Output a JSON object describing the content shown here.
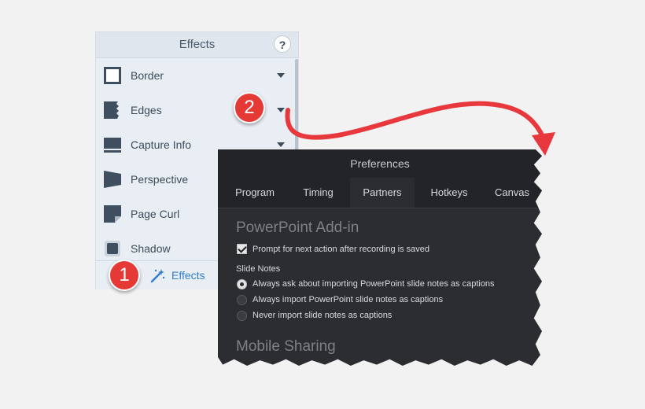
{
  "effects_panel": {
    "title": "Effects",
    "help_label": "?",
    "items": [
      {
        "label": "Border",
        "icon": "border-icon"
      },
      {
        "label": "Edges",
        "icon": "edges-icon"
      },
      {
        "label": "Capture Info",
        "icon": "capture-info-icon"
      },
      {
        "label": "Perspective",
        "icon": "perspective-icon"
      },
      {
        "label": "Page Curl",
        "icon": "page-curl-icon"
      },
      {
        "label": "Shadow",
        "icon": "shadow-icon"
      }
    ],
    "footer_label": "Effects",
    "footer_icon": "magic-wand-icon"
  },
  "preferences": {
    "title": "Preferences",
    "tabs": [
      "Program",
      "Timing",
      "Partners",
      "Hotkeys",
      "Canvas"
    ],
    "active_tab": "Partners",
    "section_powerpoint": "PowerPoint Add-in",
    "prompt_option": "Prompt for next action after recording is saved",
    "prompt_checked": true,
    "slide_notes_label": "Slide Notes",
    "radio_options": [
      "Always ask about importing PowerPoint slide notes as captions",
      "Always import PowerPoint slide notes as captions",
      "Never import slide notes as captions"
    ],
    "radio_selected": 0,
    "section_mobile": "Mobile Sharing"
  },
  "callouts": {
    "one": "1",
    "two": "2"
  },
  "colors": {
    "callout": "#e53935",
    "arrow": "#e8383d",
    "link": "#2f7fc9",
    "dialog_bg": "#2b2d31"
  }
}
